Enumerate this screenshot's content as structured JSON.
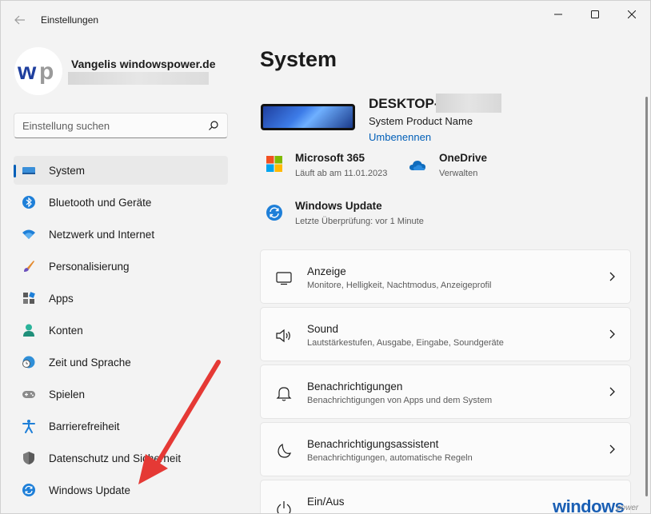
{
  "window": {
    "app_title": "Einstellungen",
    "back_icon": "arrow-left-icon",
    "controls": [
      "minimize-icon",
      "maximize-icon",
      "close-icon"
    ]
  },
  "profile": {
    "initials": "wp",
    "name": "Vangelis windowspower.de"
  },
  "search": {
    "placeholder": "Einstellung suchen"
  },
  "sidebar": {
    "items": [
      {
        "label": "System",
        "icon": "display-icon",
        "selected": true
      },
      {
        "label": "Bluetooth und Geräte",
        "icon": "bluetooth-icon"
      },
      {
        "label": "Netzwerk und Internet",
        "icon": "wifi-icon"
      },
      {
        "label": "Personalisierung",
        "icon": "brush-icon"
      },
      {
        "label": "Apps",
        "icon": "apps-icon"
      },
      {
        "label": "Konten",
        "icon": "person-icon"
      },
      {
        "label": "Zeit und Sprache",
        "icon": "globe-clock-icon"
      },
      {
        "label": "Spielen",
        "icon": "gamepad-icon"
      },
      {
        "label": "Barrierefreiheit",
        "icon": "accessibility-icon"
      },
      {
        "label": "Datenschutz und Sicherheit",
        "icon": "shield-icon"
      },
      {
        "label": "Windows Update",
        "icon": "sync-icon"
      }
    ]
  },
  "main": {
    "title": "System",
    "device": {
      "name": "DESKTOP-",
      "model": "System Product Name",
      "rename": "Umbenennen"
    },
    "info": {
      "m365_title": "Microsoft 365",
      "m365_sub": "Läuft ab am 11.01.2023",
      "onedrive_title": "OneDrive",
      "onedrive_sub": "Verwalten",
      "update_title": "Windows Update",
      "update_sub": "Letzte Überprüfung: vor 1 Minute"
    },
    "cards": [
      {
        "title": "Anzeige",
        "sub": "Monitore, Helligkeit, Nachtmodus, Anzeigeprofil",
        "icon": "monitor-icon"
      },
      {
        "title": "Sound",
        "sub": "Lautstärkestufen, Ausgabe, Eingabe, Soundgeräte",
        "icon": "speaker-icon"
      },
      {
        "title": "Benachrichtigungen",
        "sub": "Benachrichtigungen von Apps und dem System",
        "icon": "bell-icon"
      },
      {
        "title": "Benachrichtigungsassistent",
        "sub": "Benachrichtigungen, automatische Regeln",
        "icon": "moon-icon"
      },
      {
        "title": "Ein/Aus",
        "sub": "",
        "icon": "power-icon"
      }
    ]
  },
  "watermark": {
    "text": "windows",
    "suffix": "power"
  },
  "colors": {
    "accent": "#005fb8",
    "arrow": "#e53935"
  }
}
